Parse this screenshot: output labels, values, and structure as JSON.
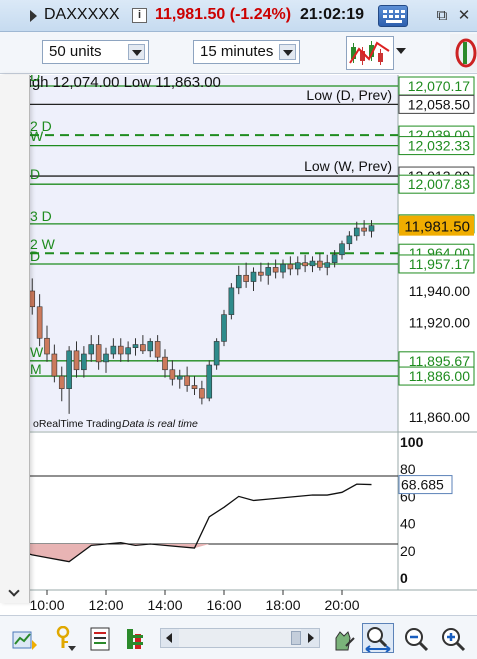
{
  "window": {
    "symbol": "DAXXXXX",
    "last_price": "11,981.50 (-1.24%)",
    "clock": "21:02:19",
    "icons": [
      "info-icon",
      "keyboard-icon",
      "restore-icon",
      "close-icon"
    ]
  },
  "toolbar": {
    "units_value": "50 units",
    "timeframe_value": "15 minutes",
    "icons": [
      "chart-type-icon",
      "chevron-down-icon",
      "drawing-tool-icon"
    ]
  },
  "chart": {
    "header_text": "y High 12,074.00 Low 11,863.00",
    "source_label": "oRealTime Trading",
    "data_status": "Data is real time",
    "level_labels": [
      "Low (D, Prev)",
      "Low (W, Prev)"
    ],
    "left_marks": [
      "D",
      "2 D",
      "W",
      "D",
      "3 D",
      "2 W",
      "D",
      "W",
      "M"
    ],
    "current_price_tag": "11,981.50",
    "indicator_value_tag": "68.685",
    "colors": {
      "level_line": "#1f8c1f",
      "price_tag_bg": "#f0ad00",
      "bull_candle": "#2e8b8b",
      "bear_candle": "#cc7a5c",
      "oversold_fill": "#e8b4b4",
      "panel_bg": "#eef0fb"
    }
  },
  "chart_data": [
    {
      "type": "candlestick",
      "title": "",
      "x_ticks": [
        "10:00",
        "12:00",
        "14:00",
        "16:00",
        "18:00",
        "20:00"
      ],
      "y_ticks": [
        11940,
        11920,
        11860
      ],
      "levels": [
        12070.17,
        12058.5,
        12039.0,
        12032.33,
        12013.0,
        12007.83,
        11982.62,
        11964.0,
        11957.17,
        11895.67,
        11886.0
      ],
      "dashed_levels": [
        12039.0,
        11964.0
      ],
      "current_price": 11981.5,
      "ohlc": [
        [
          8.5,
          12010,
          12015,
          11985,
          11990
        ],
        [
          8.75,
          11990,
          11995,
          11965,
          11970
        ],
        [
          9.0,
          11970,
          11975,
          11950,
          11958
        ],
        [
          9.25,
          11958,
          11962,
          11935,
          11940
        ],
        [
          9.5,
          11940,
          11948,
          11925,
          11930
        ],
        [
          9.75,
          11930,
          11938,
          11905,
          11910
        ],
        [
          10.0,
          11910,
          11918,
          11895,
          11900
        ],
        [
          10.25,
          11900,
          11906,
          11882,
          11886
        ],
        [
          10.5,
          11886,
          11892,
          11870,
          11878
        ],
        [
          10.75,
          11878,
          11905,
          11862,
          11902
        ],
        [
          11.0,
          11902,
          11908,
          11885,
          11890
        ],
        [
          11.25,
          11890,
          11905,
          11885,
          11900
        ],
        [
          11.5,
          11900,
          11912,
          11895,
          11906
        ],
        [
          11.75,
          11906,
          11912,
          11890,
          11895
        ],
        [
          12.0,
          11895,
          11904,
          11888,
          11900
        ],
        [
          12.25,
          11900,
          11910,
          11897,
          11905
        ],
        [
          12.5,
          11905,
          11910,
          11895,
          11900
        ],
        [
          12.75,
          11900,
          11908,
          11895,
          11904
        ],
        [
          13.0,
          11904,
          11910,
          11899,
          11906
        ],
        [
          13.25,
          11906,
          11912,
          11900,
          11902
        ],
        [
          13.5,
          11902,
          11910,
          11898,
          11908
        ],
        [
          13.75,
          11908,
          11912,
          11895,
          11898
        ],
        [
          14.0,
          11898,
          11903,
          11885,
          11890
        ],
        [
          14.25,
          11890,
          11896,
          11880,
          11884
        ],
        [
          14.5,
          11884,
          11890,
          11878,
          11886
        ],
        [
          14.75,
          11886,
          11892,
          11876,
          11880
        ],
        [
          15.0,
          11880,
          11886,
          11874,
          11878
        ],
        [
          15.25,
          11878,
          11883,
          11868,
          11872
        ],
        [
          15.5,
          11872,
          11896,
          11870,
          11893
        ],
        [
          15.75,
          11893,
          11910,
          11890,
          11908
        ],
        [
          16.0,
          11908,
          11928,
          11905,
          11925
        ],
        [
          16.25,
          11925,
          11945,
          11922,
          11942
        ],
        [
          16.5,
          11942,
          11956,
          11938,
          11950
        ],
        [
          16.75,
          11950,
          11958,
          11942,
          11946
        ],
        [
          17.0,
          11946,
          11955,
          11940,
          11952
        ],
        [
          17.25,
          11952,
          11958,
          11946,
          11950
        ],
        [
          17.5,
          11950,
          11958,
          11944,
          11955
        ],
        [
          17.75,
          11955,
          11960,
          11948,
          11952
        ],
        [
          18.0,
          11952,
          11960,
          11948,
          11957
        ],
        [
          18.25,
          11957,
          11962,
          11950,
          11954
        ],
        [
          18.5,
          11954,
          11962,
          11950,
          11958
        ],
        [
          18.75,
          11958,
          11963,
          11952,
          11956
        ],
        [
          19.0,
          11956,
          11962,
          11952,
          11959
        ],
        [
          19.25,
          11959,
          11964,
          11953,
          11955
        ],
        [
          19.5,
          11955,
          11963,
          11950,
          11958
        ],
        [
          19.75,
          11958,
          11966,
          11955,
          11963
        ],
        [
          20.0,
          11963,
          11972,
          11960,
          11970
        ],
        [
          20.25,
          11970,
          11978,
          11966,
          11975
        ],
        [
          20.5,
          11975,
          11984,
          11972,
          11980
        ],
        [
          20.75,
          11980,
          11985,
          11975,
          11978
        ],
        [
          21.0,
          11978,
          11985,
          11974,
          11981.5
        ]
      ]
    },
    {
      "type": "line",
      "title": "",
      "y_ticks": [
        100,
        80,
        60,
        40,
        20,
        0
      ],
      "ylim": [
        0,
        100
      ],
      "reference_lines": [
        75,
        25
      ],
      "last_value": 68.685,
      "x": [
        8.5,
        9,
        9.5,
        10,
        10.5,
        10.75,
        11,
        11.5,
        12,
        12.5,
        13,
        13.5,
        14,
        14.5,
        15,
        15.5,
        16,
        16.5,
        17,
        17.5,
        18,
        18.5,
        19,
        19.5,
        20,
        20.5,
        21
      ],
      "values": [
        25,
        20,
        17,
        15,
        13,
        12,
        16,
        24,
        25,
        26,
        24,
        25,
        24,
        23,
        22,
        45,
        52,
        60,
        57,
        58,
        59,
        60,
        61,
        61,
        63,
        69,
        68.7
      ]
    }
  ]
}
